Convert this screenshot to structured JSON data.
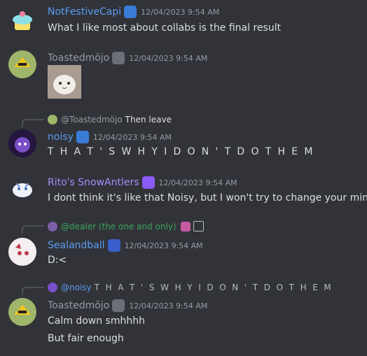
{
  "messages": [
    {
      "username": "NotFestiveCapi",
      "timestamp": "12/04/2023 9:54 AM",
      "text": "What I like most about collabs is the final result",
      "name_color": "#5b9cf2"
    },
    {
      "username": "Toastedmöjo",
      "timestamp": "12/04/2023 9:54 AM",
      "attachment": "cat image",
      "name_color": "#949ba4"
    },
    {
      "reply": {
        "name": "@Toastedmöjo",
        "text": "Then leave"
      },
      "username": "noisy",
      "timestamp": "12/04/2023 9:54 AM",
      "text": "T H A T ' S W H Y I D O N ' T D O T H E M",
      "name_color": "#5b9cf2"
    },
    {
      "username": "Rito's SnowAntlers",
      "timestamp": "12/04/2023 9:54 AM",
      "text": "I dont think it's like that Noisy, but I won't try to change your mind",
      "name_color": "#a78bfa"
    },
    {
      "reply": {
        "name": "@dealer (the one and only)",
        "text": ""
      },
      "username": "Sealandball",
      "timestamp": "12/04/2023 9:54 AM",
      "text": "D:<",
      "name_color": "#5b9cf2",
      "reply_color": "#3ba55c"
    },
    {
      "reply": {
        "name": "@noisy",
        "text": "T H A T ' S W H Y I D O N ' T D O T H E M"
      },
      "username": "Toastedmöjo",
      "timestamp": "12/04/2023 9:54 AM",
      "text": "Calm down smhhhh",
      "text2": "But fair enough",
      "name_color": "#949ba4"
    }
  ]
}
